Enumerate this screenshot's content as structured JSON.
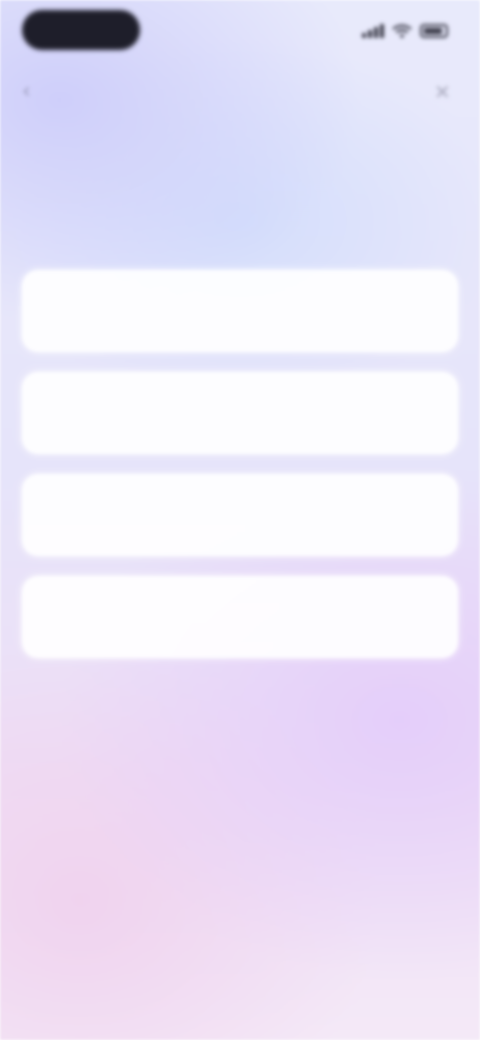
{
  "status_bar": {
    "time": ""
  },
  "nav": {
    "title": "",
    "back_glyph": "‹",
    "close_glyph": "✕"
  },
  "question": {
    "text": ""
  },
  "options": [
    {
      "label": ""
    },
    {
      "label": ""
    },
    {
      "label": ""
    },
    {
      "label": ""
    }
  ],
  "icons": {
    "signal": "signal-icon",
    "wifi": "wifi-icon",
    "battery": "battery-icon",
    "back": "chevron-left-icon",
    "close": "close-icon"
  },
  "colors": {
    "status_pill": "#1e1e2a",
    "card": "#ffffff",
    "heading_text": "#2c2c3a"
  }
}
